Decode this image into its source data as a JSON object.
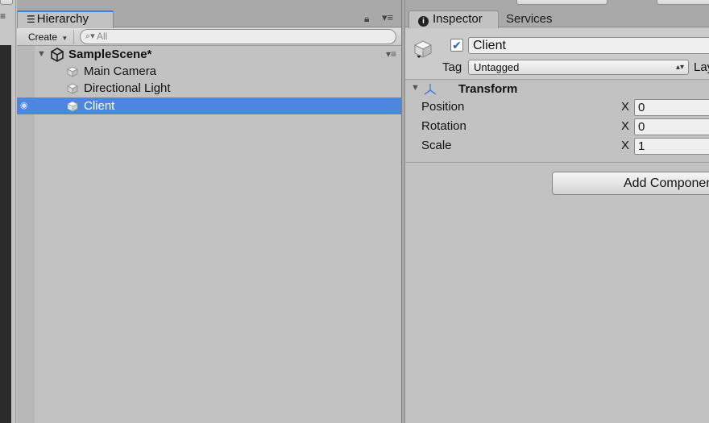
{
  "hierarchy": {
    "tab_label": "Hierarchy",
    "create_label": "Create",
    "search_placeholder": "All",
    "scene": {
      "name": "SampleScene*"
    },
    "items": [
      {
        "label": "Main Camera",
        "selected": false
      },
      {
        "label": "Directional Light",
        "selected": false
      },
      {
        "label": "Client",
        "selected": true
      }
    ]
  },
  "inspector": {
    "tab_label": "Inspector",
    "services_tab_label": "Services",
    "object_name": "Client",
    "active": true,
    "tag_label": "Tag",
    "tag_value": "Untagged",
    "layer_label": "Lay",
    "transform": {
      "title": "Transform",
      "rows": [
        {
          "label": "Position",
          "axis": "X",
          "value": "0"
        },
        {
          "label": "Rotation",
          "axis": "X",
          "value": "0"
        },
        {
          "label": "Scale",
          "axis": "X",
          "value": "1"
        }
      ]
    },
    "add_component_label": "Add Component"
  },
  "colors": {
    "selection": "#4d86de",
    "tab_accent": "#3f7fd6",
    "panel_bg": "#c2c2c2"
  }
}
